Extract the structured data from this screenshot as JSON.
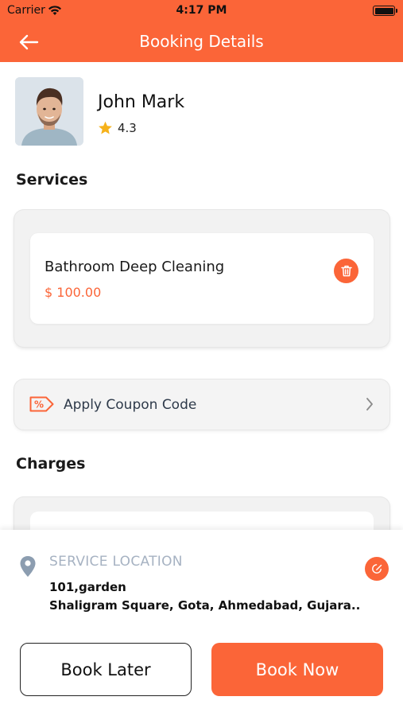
{
  "status": {
    "carrier": "Carrier",
    "time": "4:17 PM"
  },
  "header": {
    "title": "Booking Details"
  },
  "provider": {
    "name": "John Mark",
    "rating": "4.3"
  },
  "services": {
    "title": "Services",
    "items": [
      {
        "name": "Bathroom Deep Cleaning",
        "price": "$ 100.00"
      }
    ]
  },
  "coupon": {
    "label": "Apply Coupon Code"
  },
  "charges": {
    "title": "Charges"
  },
  "location": {
    "label": "SERVICE LOCATION",
    "line1": "101,garden",
    "line2": "Shaligram Square, Gota, Ahmedabad, Gujara..."
  },
  "actions": {
    "book_later": "Book Later",
    "book_now": "Book Now"
  },
  "colors": {
    "accent": "#fb6538",
    "muted": "#a6b2c2",
    "card": "#f2f2f2",
    "star": "#f6b21b"
  }
}
